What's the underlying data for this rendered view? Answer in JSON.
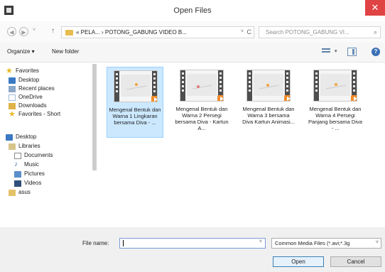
{
  "window": {
    "title": "Open Files",
    "close": "✕"
  },
  "address": {
    "back": "◀",
    "forward": "▶",
    "recent_chevron": "˅",
    "up": "↑",
    "path": "« PELA... › POTONG_GABUNG VIDEO B...",
    "chevron": "˅",
    "refresh": "C",
    "search_placeholder": "Search POTONG_GABUNG VI...",
    "search_icon": "⌕"
  },
  "toolbar": {
    "organize": "Organize ▾",
    "new_folder": "New folder",
    "view_chevron": "▾",
    "help": "?"
  },
  "nav": {
    "items": [
      {
        "label": "Favorites",
        "icon": "star-icon"
      },
      {
        "label": "Desktop",
        "icon": "desktop-icon"
      },
      {
        "label": "Recent places",
        "icon": "recent-places-icon"
      },
      {
        "label": "OneDrive",
        "icon": "onedrive-icon"
      },
      {
        "label": "Downloads",
        "icon": "downloads-icon"
      },
      {
        "label": "Favorites - Short",
        "icon": "star-icon"
      },
      {
        "label": "Desktop",
        "icon": "desktop-icon"
      },
      {
        "label": "Libraries",
        "icon": "libraries-icon"
      },
      {
        "label": "Documents",
        "icon": "documents-icon"
      },
      {
        "label": "Music",
        "icon": "music-icon"
      },
      {
        "label": "Pictures",
        "icon": "pictures-icon"
      },
      {
        "label": "Videos",
        "icon": "videos-icon"
      },
      {
        "label": "asus",
        "icon": "user-folder-icon"
      }
    ]
  },
  "files": [
    {
      "name": "Mengenal Bentuk dan Warna 1 Lingkaran bersama Diva - ...",
      "selected": true
    },
    {
      "name": "Mengenal Bentuk dan Warna 2 Persegi bersama Diva - Kartun A...",
      "selected": false
    },
    {
      "name": "Mengenal Bentuk dan Warna 3 bersama Diva Kartun Animasi...",
      "selected": false
    },
    {
      "name": "Mengenal Bentuk dan Warna 4 Persegi Panjang bersama Diva - ...",
      "selected": false
    }
  ],
  "bottom": {
    "file_name_label": "File name:",
    "file_name_value": "",
    "file_type": "Common Media Files (*.avi;*.3g",
    "open_label": "Open",
    "cancel_label": "Cancel"
  }
}
